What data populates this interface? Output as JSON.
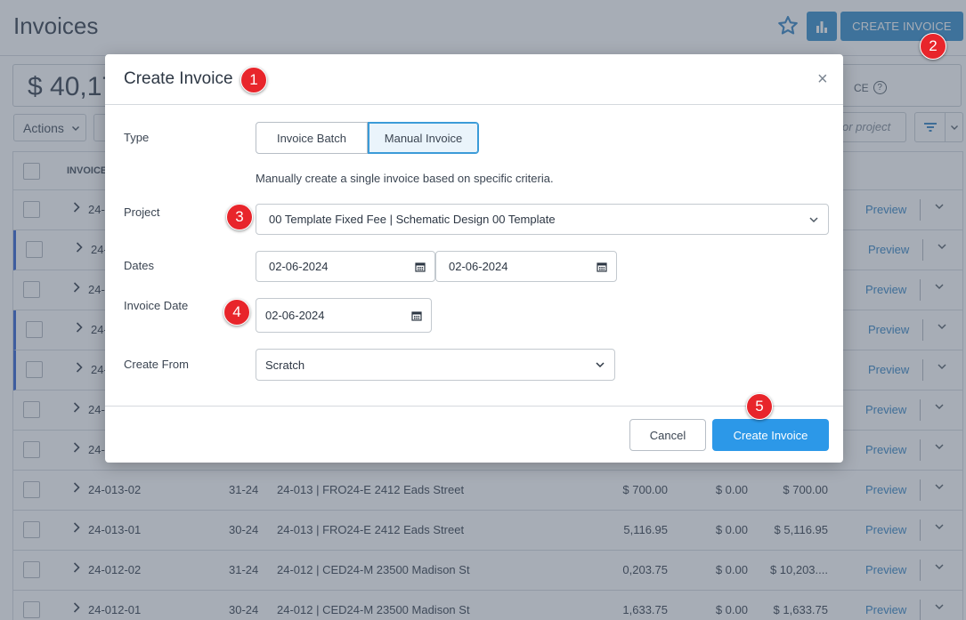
{
  "page": {
    "title": "Invoices",
    "create_invoice_label": "CREATE INVOICE",
    "amount": "$ 40,17",
    "amount_suffix": "CE",
    "help_glyph": "?",
    "actions_label": "Actions",
    "search_placeholder": "or project",
    "table_header_invoice": "INVOICE",
    "icons": [
      "star-icon",
      "bar-chart-icon",
      "filter-icon",
      "chevron-down-icon",
      "calendar-icon",
      "close-icon"
    ],
    "accent_color": "#2d89c8",
    "rows": [
      {
        "invoice": "24-",
        "date": "",
        "project": "",
        "amt1": "",
        "amt2": "",
        "amt3": "",
        "preview": "Preview",
        "flag": false
      },
      {
        "invoice": "24-",
        "date": "",
        "project": "",
        "amt1": "",
        "amt2": "",
        "amt3": "",
        "preview": "Preview",
        "flag": true
      },
      {
        "invoice": "24-",
        "date": "",
        "project": "",
        "amt1": "",
        "amt2": "",
        "amt3": "",
        "preview": "Preview",
        "flag": false
      },
      {
        "invoice": "24-",
        "date": "",
        "project": "",
        "amt1": "",
        "amt2": "",
        "amt3": "",
        "preview": "Preview",
        "flag": true
      },
      {
        "invoice": "24-",
        "date": "",
        "project": "",
        "amt1": "",
        "amt2": "",
        "amt3": "",
        "preview": "Preview",
        "flag": true
      },
      {
        "invoice": "24-",
        "date": "",
        "project": "",
        "amt1": "",
        "amt2": "",
        "amt3": "",
        "preview": "Preview",
        "flag": false
      },
      {
        "invoice": "24-",
        "date": "",
        "project": "",
        "amt1": "",
        "amt2": "",
        "amt3": "",
        "preview": "Preview",
        "flag": false
      },
      {
        "invoice": "24-013-02",
        "date": "31-24",
        "project": "24-013 | FRO24-E 2412 Eads Street",
        "amt1": "$ 700.00",
        "amt2": "$ 0.00",
        "amt3": "$ 700.00",
        "preview": "Preview",
        "flag": false
      },
      {
        "invoice": "24-013-01",
        "date": "30-24",
        "project": "24-013 | FRO24-E 2412 Eads Street",
        "amt1": "5,116.95",
        "amt2": "$ 0.00",
        "amt3": "$ 5,116.95",
        "preview": "Preview",
        "flag": false
      },
      {
        "invoice": "24-012-02",
        "date": "31-24",
        "project": "24-012 | CED24-M 23500 Madison St",
        "amt1": "0,203.75",
        "amt2": "$ 0.00",
        "amt3": "$ 10,203....",
        "preview": "Preview",
        "flag": false
      },
      {
        "invoice": "24-012-01",
        "date": "30-24",
        "project": "24-012 | CED24-M 23500 Madison St",
        "amt1": "1,633.75",
        "amt2": "$ 0.00",
        "amt3": "$ 1,633.75",
        "preview": "Preview",
        "flag": false
      }
    ]
  },
  "modal": {
    "title": "Create Invoice",
    "close_glyph": "×",
    "type_label": "Type",
    "type_options": [
      "Invoice Batch",
      "Manual Invoice"
    ],
    "type_selected": "Manual Invoice",
    "help_text": "Manually create a single invoice based on specific criteria.",
    "project_label": "Project",
    "project_value": "00 Template Fixed Fee | Schematic Design 00 Template",
    "dates_label": "Dates",
    "date_start": "02-06-2024",
    "date_end": "02-06-2024",
    "invoice_date_label": "Invoice Date",
    "invoice_date": "02-06-2024",
    "create_from_label": "Create From",
    "create_from_value": "Scratch",
    "cancel_label": "Cancel",
    "submit_label": "Create Invoice",
    "submit_color": "#2c98e8"
  },
  "markers": [
    "1",
    "2",
    "3",
    "4",
    "5"
  ],
  "marker_color": "#e8252b"
}
